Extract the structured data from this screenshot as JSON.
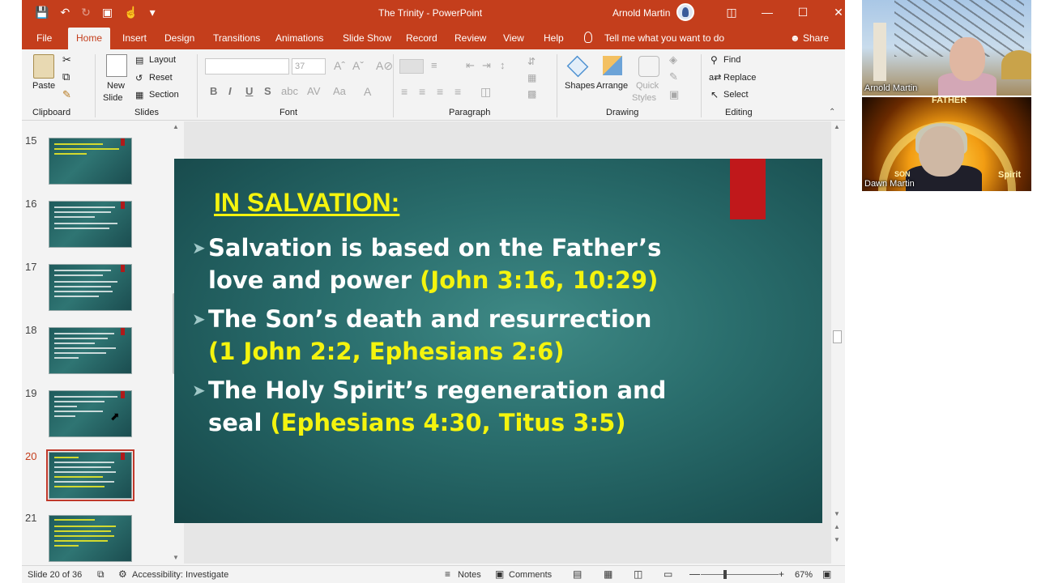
{
  "window": {
    "title": "The Trinity  -  PowerPoint",
    "user_name": "Arnold Martin"
  },
  "tabs": [
    "File",
    "Home",
    "Insert",
    "Design",
    "Transitions",
    "Animations",
    "Slide Show",
    "Record",
    "Review",
    "View",
    "Help"
  ],
  "tell_me": "Tell me what you want to do",
  "share": "Share",
  "ribbon": {
    "clipboard": {
      "paste": "Paste",
      "label": "Clipboard"
    },
    "slides": {
      "new_slide": "New",
      "new_slide2": "Slide",
      "layout": "Layout",
      "reset": "Reset",
      "section": "Section",
      "label": "Slides"
    },
    "font": {
      "font_size": "37",
      "label": "Font",
      "bold": "B",
      "italic": "I",
      "underline": "U",
      "shadow": "S"
    },
    "paragraph": {
      "label": "Paragraph"
    },
    "drawing": {
      "shapes": "Shapes",
      "arrange": "Arrange",
      "quick": "Quick",
      "styles": "Styles",
      "label": "Drawing"
    },
    "editing": {
      "find": "Find",
      "replace": "Replace",
      "select": "Select",
      "label": "Editing"
    }
  },
  "thumbnails": [
    {
      "num": "15"
    },
    {
      "num": "16"
    },
    {
      "num": "17"
    },
    {
      "num": "18"
    },
    {
      "num": "19"
    },
    {
      "num": "20"
    },
    {
      "num": "21"
    }
  ],
  "slide": {
    "heading": "IN SALVATION:",
    "bullets": [
      {
        "text": "Salvation is based on the Father’s love and power ",
        "ref": "(John 3:16, 10:29)"
      },
      {
        "text": "The Son’s death and resurrection ",
        "ref": "(1 John 2:2, Ephesians 2:6)"
      },
      {
        "text": "The Holy Spirit’s regeneration and seal ",
        "ref": "(Ephesians 4:30, Titus 3:5)"
      }
    ],
    "colors": {
      "heading": "#f4f40e",
      "body": "#ffffff",
      "bookmark": "#c0181b"
    }
  },
  "status": {
    "slide_of": "Slide 20 of 36",
    "accessibility": "Accessibility: Investigate",
    "notes": "Notes",
    "comments": "Comments",
    "zoom": "67%"
  },
  "participants": [
    {
      "name": "Arnold Martin"
    },
    {
      "name": "Dawn Martin",
      "bg_words": [
        "FATHER",
        "SON",
        "Spirit"
      ]
    }
  ],
  "theme": {
    "accent": "#c43e1c"
  }
}
